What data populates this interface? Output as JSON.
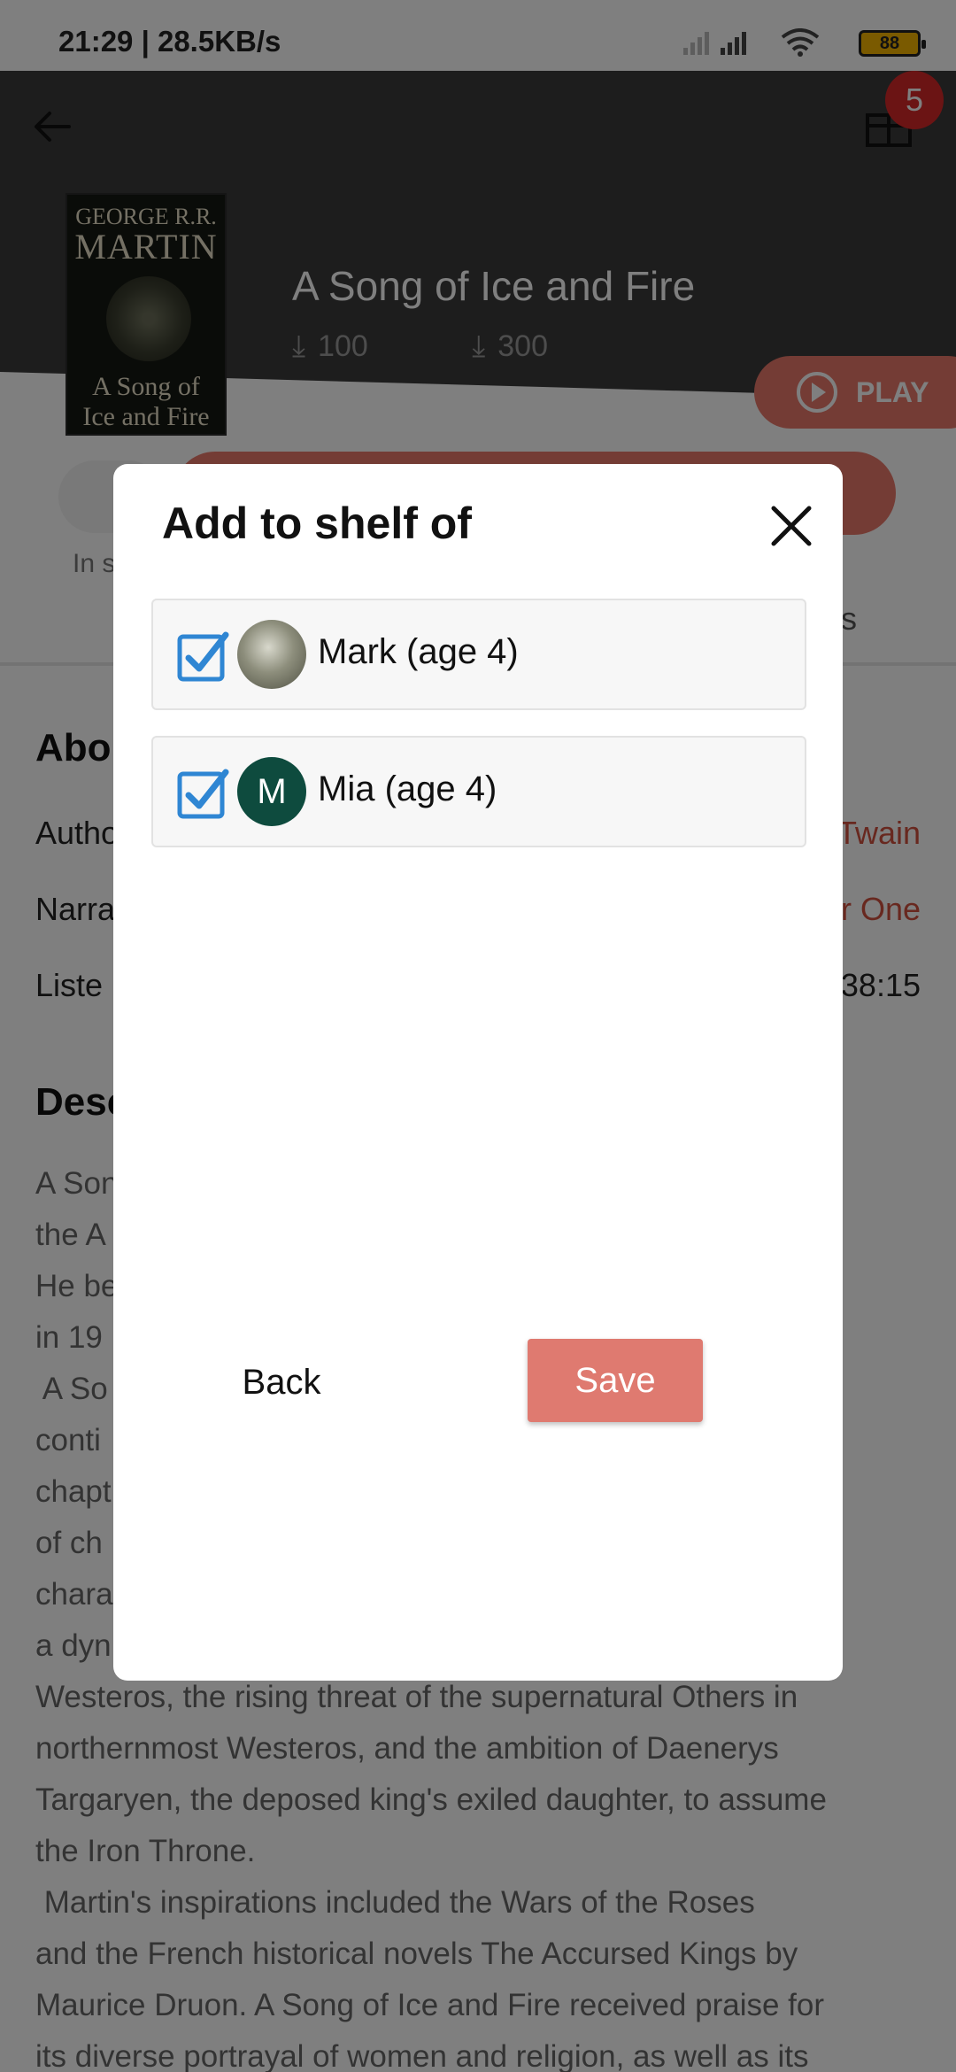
{
  "status_bar": {
    "time": "21:29 | 28.5KB/s",
    "battery": "88"
  },
  "header": {
    "gift_badge": "5"
  },
  "book": {
    "cover_author_top": "George R.R.",
    "cover_author_bottom": "Martin",
    "cover_title_line1": "A Song of",
    "cover_title_line2": "Ice and Fire",
    "title": "A Song of Ice and Fire",
    "downloads_1": "100",
    "downloads_2": "300",
    "play_label": "PLAY"
  },
  "page": {
    "shelf_label": "In s",
    "tab_fragment": "s",
    "about_heading": "Abo",
    "author_label": "Autho",
    "author_value": "Twain",
    "narrator_label": "Narra",
    "narrator_value": "r One",
    "listen_label": "Liste",
    "listen_value": "38:15",
    "description_heading": "Desc",
    "description_lines": [
      "A Son                                                                   s by",
      "the A                                                                 artin.",
      "He be                                                              ones,",
      "in 19",
      " A So",
      "conti                                                                    ach",
      "chapt",
      "of ch",
      "chara                                                                eave:",
      "a dyn",
      "Westeros, the rising threat of the supernatural Others in",
      "northernmost Westeros, and the ambition of Daenerys",
      "Targaryen, the deposed king's exiled daughter, to assume",
      "the Iron Throne.",
      " Martin's inspirations included the Wars of the Roses",
      "and the French historical novels The Accursed Kings by",
      "Maurice Druon. A Song of Ice and Fire received praise for",
      "its diverse portrayal of women and religion, as well as its"
    ]
  },
  "dialog": {
    "title": "Add to shelf of",
    "people": [
      {
        "name": "Mark (age 4)",
        "checked": true,
        "avatar": "photo"
      },
      {
        "name": "Mia (age 4)",
        "checked": true,
        "avatar": "M"
      }
    ],
    "back_label": "Back",
    "save_label": "Save"
  },
  "colors": {
    "accent": "#df7a70",
    "check": "#2f86d3",
    "avatar_bg": "#0e4b3e"
  },
  "icons": [
    "back-arrow-icon",
    "gift-icon",
    "play-icon",
    "download-icon",
    "close-icon",
    "checkbox-checked-icon",
    "wifi-icon",
    "signal-icon",
    "mute-icon",
    "battery-icon"
  ]
}
